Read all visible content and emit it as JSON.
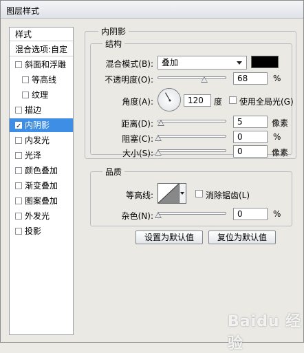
{
  "window": {
    "title": "图层样式"
  },
  "style_list": {
    "header": "样式",
    "blend_options": "混合选项:自定",
    "items": [
      {
        "label": "斜面和浮雕",
        "checked": false,
        "sub": false,
        "selected": false
      },
      {
        "label": "等高线",
        "checked": false,
        "sub": true,
        "selected": false
      },
      {
        "label": "纹理",
        "checked": false,
        "sub": true,
        "selected": false
      },
      {
        "label": "描边",
        "checked": false,
        "sub": false,
        "selected": false
      },
      {
        "label": "内阴影",
        "checked": true,
        "sub": false,
        "selected": true
      },
      {
        "label": "内发光",
        "checked": false,
        "sub": false,
        "selected": false
      },
      {
        "label": "光泽",
        "checked": false,
        "sub": false,
        "selected": false
      },
      {
        "label": "颜色叠加",
        "checked": false,
        "sub": false,
        "selected": false
      },
      {
        "label": "渐变叠加",
        "checked": false,
        "sub": false,
        "selected": false
      },
      {
        "label": "图案叠加",
        "checked": false,
        "sub": false,
        "selected": false
      },
      {
        "label": "外发光",
        "checked": false,
        "sub": false,
        "selected": false
      },
      {
        "label": "投影",
        "checked": false,
        "sub": false,
        "selected": false
      }
    ]
  },
  "panel": {
    "title": "内阴影",
    "structure": {
      "title": "结构",
      "blend_mode_label": "混合模式(B):",
      "blend_mode_value": "叠加",
      "shadow_color": "#000000",
      "opacity_label": "不透明度(O):",
      "opacity_value": "68",
      "opacity_fraction": 0.68,
      "opacity_unit": "%",
      "angle_label": "角度(A):",
      "angle_value": "120",
      "angle_unit": "度",
      "global_light_label": "使用全局光(G)",
      "distance_label": "距离(D):",
      "distance_value": "5",
      "distance_unit": "像素",
      "choke_label": "阻塞(C):",
      "choke_value": "0",
      "choke_unit": "%",
      "size_label": "大小(S):",
      "size_value": "0",
      "size_unit": "像素"
    },
    "quality": {
      "title": "品质",
      "contour_label": "等高线:",
      "antialias_label": "消除锯齿(L)",
      "noise_label": "杂色(N):",
      "noise_value": "0",
      "noise_unit": "%"
    },
    "buttons": {
      "make_default": "设置为默认值",
      "reset_default": "复位为默认值"
    }
  },
  "watermark": "Baidu 经验"
}
